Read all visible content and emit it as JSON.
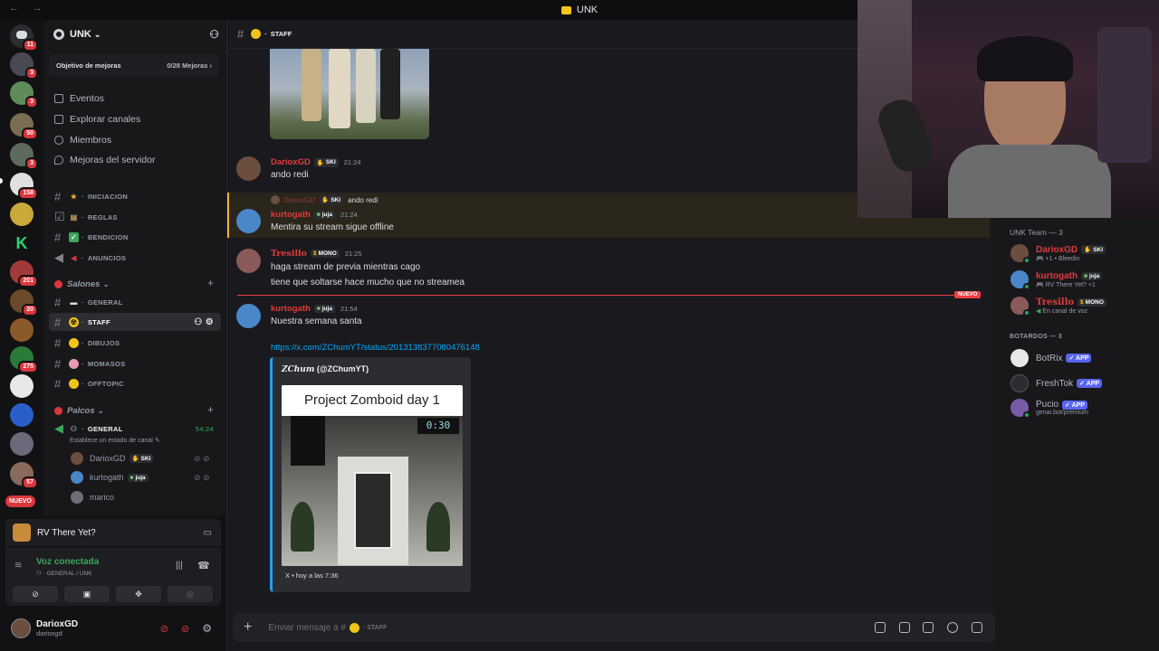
{
  "window": {
    "title": "UNK"
  },
  "rail": {
    "new_label": "NUEVO",
    "badges": [
      "11",
      "3",
      "3",
      "",
      "50",
      "3",
      "158",
      "",
      "",
      "201",
      "20",
      "",
      "275",
      "",
      "",
      "",
      "",
      "57"
    ]
  },
  "guild": {
    "name": "UNK",
    "boost": {
      "label": "Objetivo de mejoras",
      "progress": "0/28 Mejoras"
    },
    "nav": [
      "Eventos",
      "Explorar canales",
      "Miembros",
      "Mejoras del servidor"
    ],
    "channels": [
      {
        "name": "INICIACION",
        "emoji": "★"
      },
      {
        "name": "REGLAS",
        "emoji": "▤"
      },
      {
        "name": "BENDICION",
        "emoji": "✓"
      },
      {
        "name": "ANUNCIOS",
        "emoji": "◀"
      }
    ],
    "salones": {
      "label": "Salones",
      "channels": [
        {
          "name": "GENERAL",
          "emoji": "💬"
        },
        {
          "name": "STAFF",
          "emoji": "☢"
        },
        {
          "name": "DIBUJOS",
          "emoji": "🤔"
        },
        {
          "name": "MOMASOS",
          "emoji": "🧠"
        },
        {
          "name": "OFFTOPIC",
          "emoji": "🤔"
        }
      ]
    },
    "palcos": {
      "label": "Palcos",
      "channel": "GENERAL",
      "time": "54:24",
      "status_prompt": "Establece un estado de canal",
      "users": [
        {
          "name": "DarioxGD",
          "tag": "SKI"
        },
        {
          "name": "kurtogath",
          "tag": "juja"
        },
        {
          "name": "marico",
          "tag": ""
        }
      ]
    }
  },
  "activity": {
    "game": "RV There Yet?"
  },
  "voice": {
    "status": "Voz conectada",
    "location": "GENERAL / UNK"
  },
  "user": {
    "name": "DarioxGD",
    "handle": "darioxgd"
  },
  "channel_header": {
    "name": "STAFF"
  },
  "messages": [
    {
      "author": "DarioxGD",
      "tag": "SKI",
      "time": "21:24",
      "lines": [
        "ando redi"
      ],
      "color": "#e03b3b"
    },
    {
      "reply_to": {
        "author": "DarioxGD",
        "tag": "SKI",
        "text": "ando redi"
      },
      "author": "kurtogath",
      "tag": "juja",
      "time": "21:24",
      "lines": [
        "Mentira su stream sigue offline"
      ],
      "color": "#e03b3b"
    },
    {
      "author": "Tresillo",
      "tag": "MONO",
      "time": "21:25",
      "lines": [
        "haga stream de previa mientras cago",
        "tiene que soltarse hace mucho que no streamea"
      ],
      "color": "#e03b3b"
    },
    {
      "author": "kurtogath",
      "tag": "juja",
      "time": "21:54",
      "lines": [
        "Nuestra semana santa"
      ],
      "color": "#e03b3b",
      "link": "https://x.com/ZChumYT/status/2013138377080476148",
      "embed": {
        "author_name": "ZChum",
        "author_handle": "(@ZChumYT)",
        "card_title": "Project Zomboid day 1",
        "game_clock": "0:30",
        "footer": "X • hoy a las 7:36"
      }
    }
  ],
  "new_divider": "NUEVO",
  "composer": {
    "placeholder": "Enviar mensaje a #",
    "channel": "STAFF"
  },
  "members": {
    "team_header": "UNK Team — 3",
    "team": [
      {
        "name": "DarioxGD",
        "tag": "SKI",
        "status": "+1 • Bleedin"
      },
      {
        "name": "kurtogath",
        "tag": "juja",
        "status": "RV There Yet? +1"
      },
      {
        "name": "Tresillo",
        "tag": "MONO",
        "status": "En canal de voz"
      }
    ],
    "bots_header": "BOTARDOS — 3",
    "bots": [
      {
        "name": "BotRix",
        "tag": "APP",
        "status": ""
      },
      {
        "name": "FreshTok",
        "tag": "APP",
        "status": ""
      },
      {
        "name": "Pucio",
        "tag": "APP",
        "status": "genai.bot/premium"
      }
    ]
  },
  "colors": {
    "accent": "#5865f2",
    "danger": "#da373c",
    "online": "#23a55a",
    "link": "#00a8fc",
    "name_red": "#e03b3b"
  }
}
